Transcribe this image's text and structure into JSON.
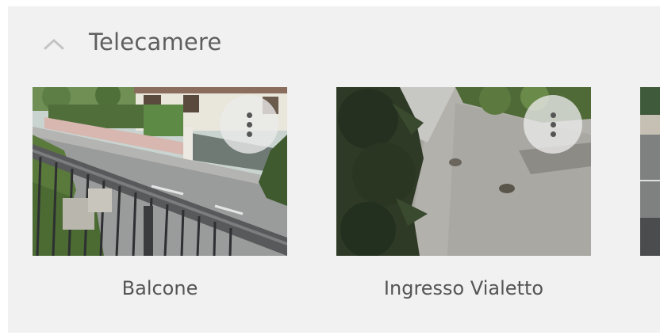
{
  "section": {
    "title": "Telecamere",
    "collapse_icon": "chevron-up-icon"
  },
  "cameras": [
    {
      "name": "Balcone",
      "menu_icon": "more-vertical-icon"
    },
    {
      "name": "Ingresso Vialetto",
      "menu_icon": "more-vertical-icon"
    }
  ],
  "colors": {
    "panel_background": "#f1f1f1",
    "title_text": "#5f5f5f",
    "label_text": "#555555"
  }
}
